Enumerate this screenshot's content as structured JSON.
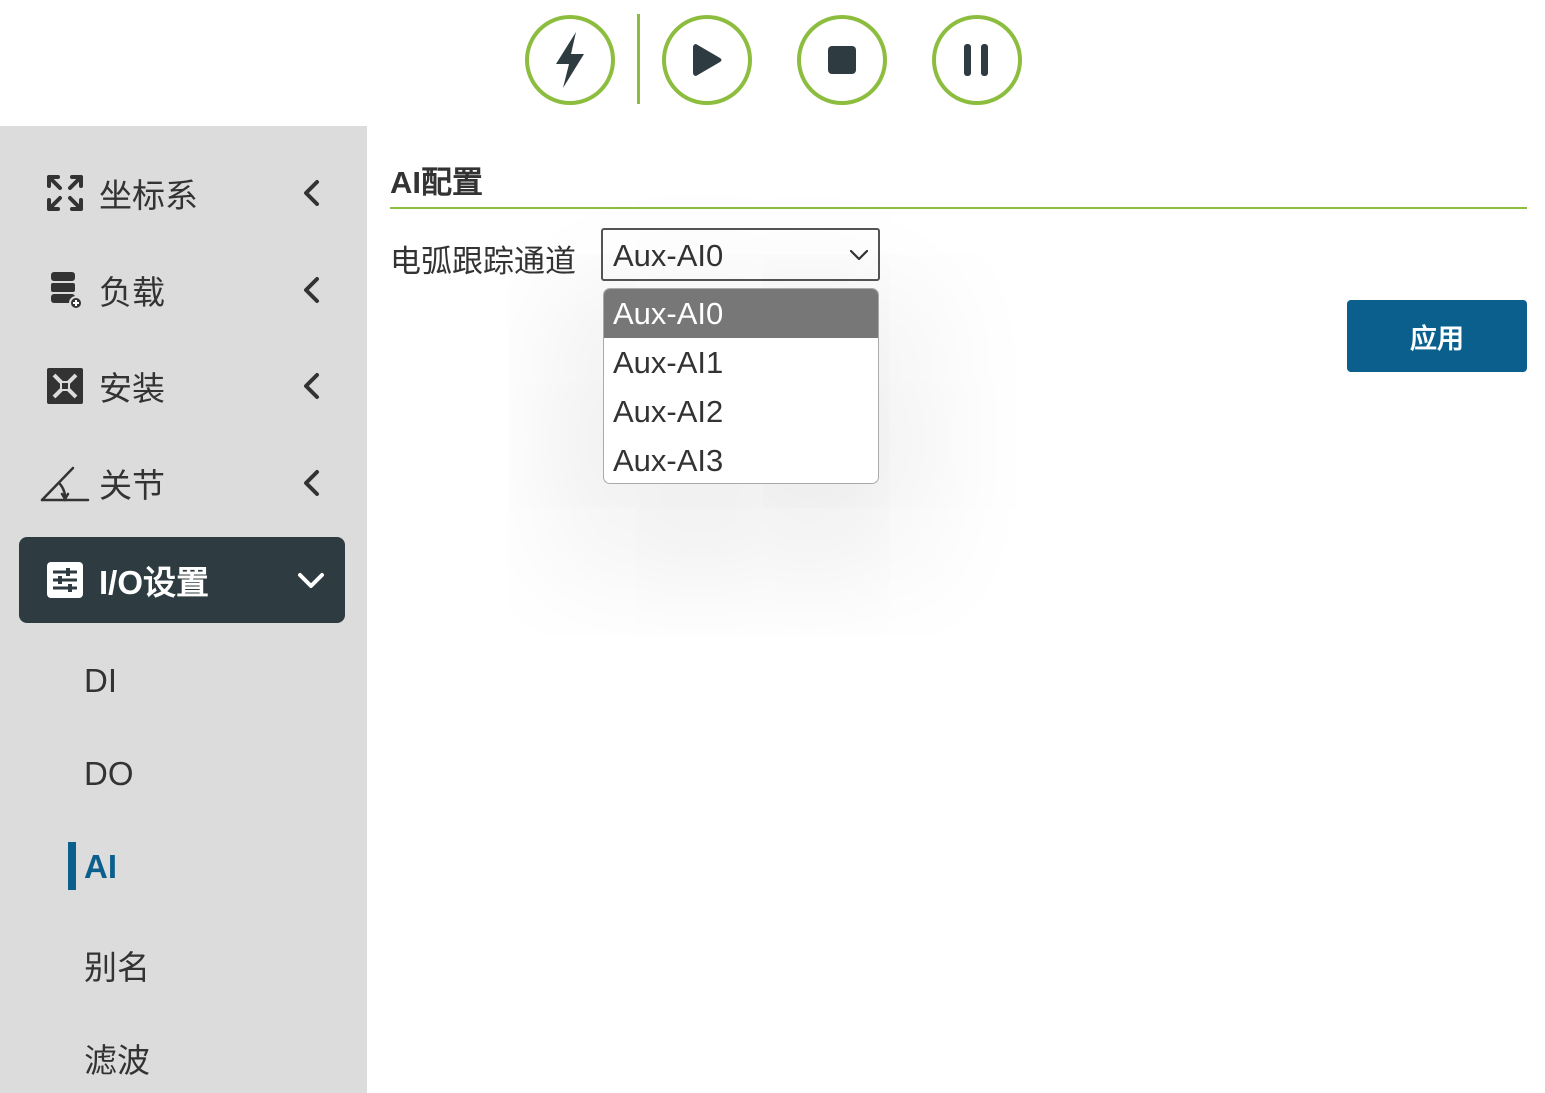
{
  "colors": {
    "accent_green": "#8cbd3f",
    "primary_blue": "#0a5f8c",
    "sidebar_bg": "#dcdcdc",
    "active_item_bg": "#2e3c42",
    "dropdown_selected_bg": "#777777"
  },
  "toolbar": {
    "buttons": [
      {
        "name": "power",
        "icon": "lightning-icon"
      },
      {
        "name": "run",
        "icon": "play-icon"
      },
      {
        "name": "stop",
        "icon": "stop-icon"
      },
      {
        "name": "pause",
        "icon": "pause-icon"
      }
    ]
  },
  "sidebar": {
    "items": [
      {
        "label": "坐标系",
        "icon": "coordinate-expand-icon",
        "expanded": false
      },
      {
        "label": "负载",
        "icon": "payload-icon",
        "expanded": false
      },
      {
        "label": "安装",
        "icon": "installation-icon",
        "expanded": false
      },
      {
        "label": "关节",
        "icon": "joint-angle-icon",
        "expanded": false
      },
      {
        "label": "I/O设置",
        "icon": "io-settings-icon",
        "expanded": true,
        "active": true
      }
    ],
    "subitems": [
      {
        "label": "DI"
      },
      {
        "label": "DO"
      },
      {
        "label": "AI",
        "current": true
      },
      {
        "label": "别名"
      },
      {
        "label": "滤波"
      }
    ]
  },
  "main": {
    "section_title": "AI配置",
    "field_label": "电弧跟踪通道",
    "select": {
      "value": "Aux-AI0",
      "options": [
        "Aux-AI0",
        "Aux-AI1",
        "Aux-AI2",
        "Aux-AI3"
      ],
      "selected_index": 0,
      "open": true
    },
    "apply_label": "应用"
  }
}
